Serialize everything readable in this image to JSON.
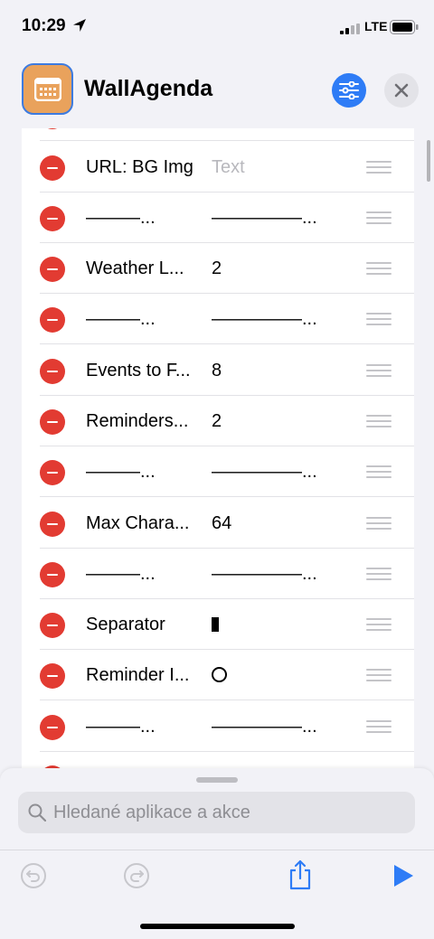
{
  "status_bar": {
    "time": "10:29",
    "network": "LTE"
  },
  "header": {
    "title": "WallAgenda"
  },
  "rows": [
    {
      "key": "URL: BG Img",
      "value": "Text",
      "value_type": "placeholder"
    },
    {
      "key": "———...",
      "value": "—————..."
    },
    {
      "key": "Weather L...",
      "value": "2"
    },
    {
      "key": "———...",
      "value": "—————..."
    },
    {
      "key": "Events to F...",
      "value": "8"
    },
    {
      "key": "Reminders...",
      "value": "2"
    },
    {
      "key": "———...",
      "value": "—————..."
    },
    {
      "key": "Max Chara...",
      "value": "64"
    },
    {
      "key": "———...",
      "value": "—————..."
    },
    {
      "key": "Separator",
      "value": "",
      "value_type": "separator-bar"
    },
    {
      "key": "Reminder I...",
      "value": "",
      "value_type": "circle"
    },
    {
      "key": "———...",
      "value": "—————..."
    }
  ],
  "search": {
    "placeholder": "Hledané aplikace a akce"
  },
  "colors": {
    "accent": "#2e7cf6",
    "delete": "#e23b32",
    "app_icon": "#e9a25c"
  },
  "icons": [
    "location-arrow-icon",
    "signal-bars-icon",
    "battery-icon",
    "calendar-icon",
    "sliders-icon",
    "close-icon",
    "minus-icon",
    "drag-handle-icon",
    "search-icon",
    "undo-icon",
    "redo-icon",
    "share-icon",
    "play-icon"
  ]
}
